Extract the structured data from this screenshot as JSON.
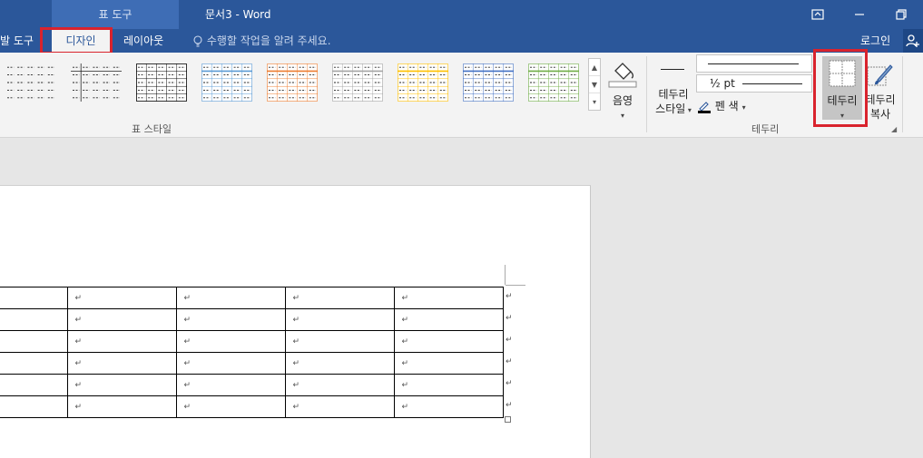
{
  "titlebar": {
    "context_tab": "표 도구",
    "doc_title": "문서3  -  Word"
  },
  "tabs": {
    "developer": "발 도구",
    "design": "디자인",
    "layout": "레이아웃",
    "tellme": "수행할 작업을 알려 주세요.",
    "login": "로그인"
  },
  "ribbon": {
    "table_styles_label": "표 스타일",
    "shading_label": "음영",
    "border_style_label_1": "테두리",
    "border_style_label_2": "스타일",
    "line_weight": "½ pt",
    "pen_color_label": "펜 색",
    "borders_label": "테두리",
    "painter_label_1": "테두리",
    "painter_label_2": "복사",
    "borders_group_label": "테두리"
  },
  "table_style_colors": [
    "#000000",
    "#000000",
    "#000000",
    "#5b9bd5",
    "#ed7d31",
    "#a5a5a5",
    "#ffc000",
    "#4472c4",
    "#70ad47"
  ],
  "table": {
    "cell_mark": "↵",
    "rows": 6,
    "cols": 5
  },
  "colors": {
    "word_blue": "#2b579a",
    "highlight_red": "#d9232d"
  }
}
